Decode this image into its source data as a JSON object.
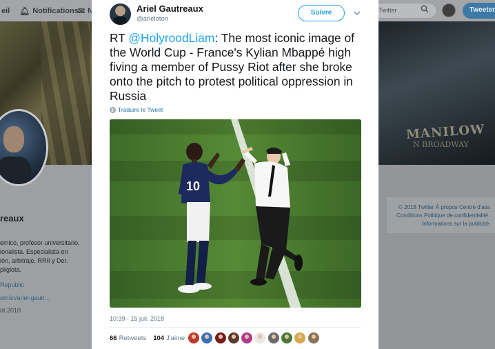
{
  "background": {
    "nav": {
      "home_label": "eil",
      "notifications_label": "Notifications",
      "messages_label": "N"
    },
    "search": {
      "placeholder": "Twitter"
    },
    "tweet_button": "Tweeter",
    "profile": {
      "name": "reaux",
      "bio": "emico, profesor universitario,\nionalista. Especialista en\nión, arbitraje, RRII y Der.\npliglota.",
      "link1": "Republic",
      "link2": "om/in/ariel-gautr...",
      "joined": "ût 2010"
    },
    "banner_text": {
      "line1": "MANILOW",
      "line2": "N BROADWAY"
    },
    "footer": {
      "line1": "© 2018 Twitter   À propos   Centre d'ass",
      "line2": "Conditions   Politique de confidentialité",
      "line3": "Informations sur la publicité"
    }
  },
  "tweet": {
    "author": {
      "name": "Ariel Gautreaux",
      "handle": "@arieloton"
    },
    "follow_label": "Suivre",
    "text_prefix": "RT ",
    "mention": "@HolyroodLiam",
    "text_body": ": The most iconic image of the World Cup - France's Kylian Mbappé high fiving a member of Pussy Riot after she broke onto the pitch to protest political oppression in Russia",
    "translate_label": "Traduire le Tweet",
    "timestamp": "10:39 - 15 juil. 2018",
    "retweets": {
      "count": "66",
      "label": "Retweets"
    },
    "likes": {
      "count": "104",
      "label": "J'aime"
    },
    "liker_colors": [
      "#c0392b",
      "#3b6fb6",
      "#7a1a1a",
      "#5a3b2e",
      "#b03a8c",
      "#e8e8e8",
      "#6b6b6b",
      "#4a7a3a",
      "#d4a84b",
      "#8b7355"
    ]
  },
  "colors": {
    "accent": "#1da1f2",
    "secondary_text": "#657786"
  }
}
